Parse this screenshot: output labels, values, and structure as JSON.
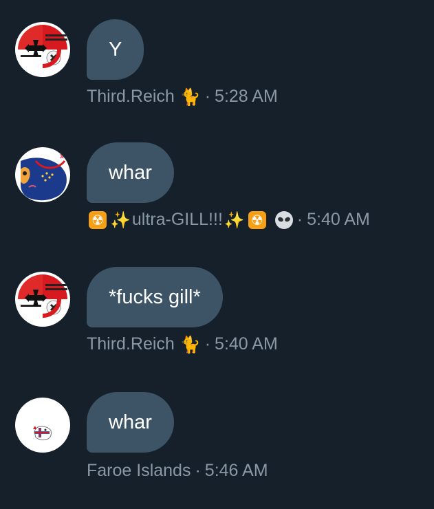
{
  "colors": {
    "background": "#15202b",
    "bubble": "#3d5466",
    "meta_text": "#8b98a5"
  },
  "messages": [
    {
      "text": "Y",
      "sender": "Third.Reich",
      "sender_emoji": "cat-emoji",
      "time": "5:28 AM",
      "avatar": "iron-cross-flag-avatar"
    },
    {
      "text": "whar",
      "sender_prefix_emoji": [
        "radioactive-emoji",
        "sparkles-emoji"
      ],
      "sender": "ultra-GILL!!!",
      "sender_suffix_emoji": [
        "sparkles-emoji",
        "radioactive-emoji",
        "alien-emoji"
      ],
      "time": "5:40 AM",
      "avatar": "blue-flag-character-avatar"
    },
    {
      "text": "*fucks gill*",
      "sender": "Third.Reich",
      "sender_emoji": "cat-emoji",
      "time": "5:40 AM",
      "avatar": "iron-cross-flag-avatar"
    },
    {
      "text": "whar",
      "sender": "Faroe Islands",
      "time": "5:46 AM",
      "avatar": "faroe-flag-character-avatar"
    }
  ],
  "separator": "·"
}
